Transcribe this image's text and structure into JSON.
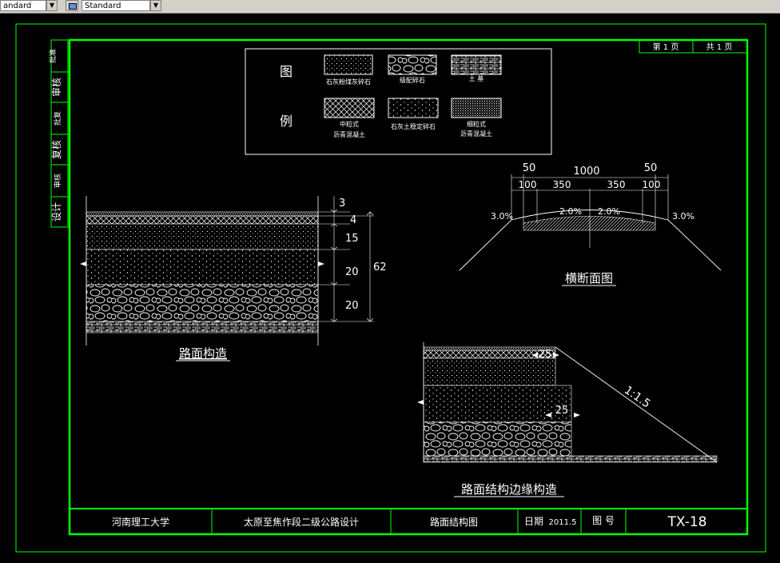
{
  "toolbar": {
    "style_combo_1": "andard",
    "style_combo_2": "Standard"
  },
  "sheet": {
    "page_no_label": "第 1 页",
    "page_total_label": "共 1 页",
    "side_labels": [
      "设计",
      "复核",
      "审核"
    ],
    "side_stamp_labels": [
      "批准",
      "批复",
      "审核"
    ]
  },
  "legend": {
    "title_1": "图",
    "title_2": "例",
    "items": [
      {
        "label": "石灰粉煤灰碎石",
        "pattern": "dots-fine"
      },
      {
        "label": "级配碎石",
        "pattern": "cobbles"
      },
      {
        "label": "土 基",
        "pattern": "brick"
      },
      {
        "label": "中粒式",
        "label2": "沥青混凝土",
        "pattern": "crosshatch"
      },
      {
        "label": "石灰土稳定碎石",
        "pattern": "dots-medium"
      },
      {
        "label": "细粒式",
        "label2": "沥青混凝土",
        "pattern": "dense-dots"
      }
    ]
  },
  "pavement_structure": {
    "title": "路面构造",
    "dims": {
      "d1": "3",
      "d2": "4",
      "d3": "15",
      "d4": "20",
      "d5": "20",
      "total": "62"
    }
  },
  "cross_section": {
    "title": "横断面图",
    "dims": {
      "total": "1000",
      "shoulder_left": "50",
      "shoulder_right": "50",
      "left_100": "100",
      "right_100": "100",
      "half_left": "350",
      "half_right": "350",
      "slope_left": "2.0%",
      "slope_right": "2.0%",
      "edge_left": "3.0%",
      "edge_right": "3.0%"
    }
  },
  "edge_detail": {
    "title": "路面结构边缘构造",
    "dims": {
      "top": "25",
      "mid": "25",
      "slope": "1:1.5"
    }
  },
  "title_block": {
    "school": "河南理工大学",
    "project": "太原至焦作段二级公路设计",
    "drawing_name": "路面结构图",
    "date_label": "日期",
    "date_value": "2011.5",
    "drawing_no_label": "图 号",
    "drawing_no": "TX-18"
  },
  "colors": {
    "background": "#000000",
    "frame": "#00ff00",
    "line": "#ffffff",
    "toolbar": "#d4d0c8"
  }
}
